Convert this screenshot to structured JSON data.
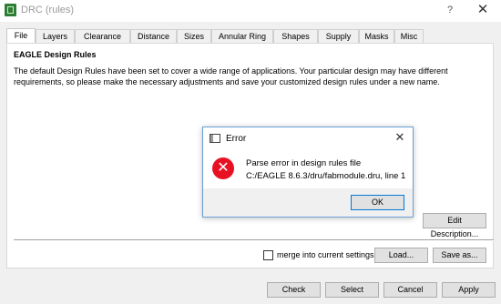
{
  "window": {
    "title": "DRC (rules)",
    "help_label": "?",
    "close_label": "✕"
  },
  "tabs": [
    {
      "label": "File",
      "active": true
    },
    {
      "label": "Layers"
    },
    {
      "label": "Clearance"
    },
    {
      "label": "Distance"
    },
    {
      "label": "Sizes"
    },
    {
      "label": "Annular Ring"
    },
    {
      "label": "Shapes"
    },
    {
      "label": "Supply"
    },
    {
      "label": "Masks"
    },
    {
      "label": "Misc"
    }
  ],
  "file_tab": {
    "heading": "EAGLE Design Rules",
    "description": "The default Design Rules have been set to cover a wide range of applications. Your particular design may have different requirements, so please make the necessary adjustments and save your customized design rules under a new name.",
    "edit_description_label": "Edit Description...",
    "merge_label": "merge into current settings",
    "merge_checked": false,
    "load_label": "Load...",
    "save_as_label": "Save as..."
  },
  "footer": {
    "check_label": "Check",
    "select_label": "Select",
    "cancel_label": "Cancel",
    "apply_label": "Apply"
  },
  "error_dialog": {
    "title": "Error",
    "close_label": "✕",
    "icon": "error-x-icon",
    "icon_glyph": "✕",
    "message_line1": "Parse error in design rules file",
    "message_line2": "C:/EAGLE 8.6.3/dru/fabmodule.dru, line 1",
    "ok_label": "OK"
  },
  "colors": {
    "error_red": "#e81123",
    "focus_blue": "#0078d7",
    "app_icon_green": "#2e7d32"
  }
}
